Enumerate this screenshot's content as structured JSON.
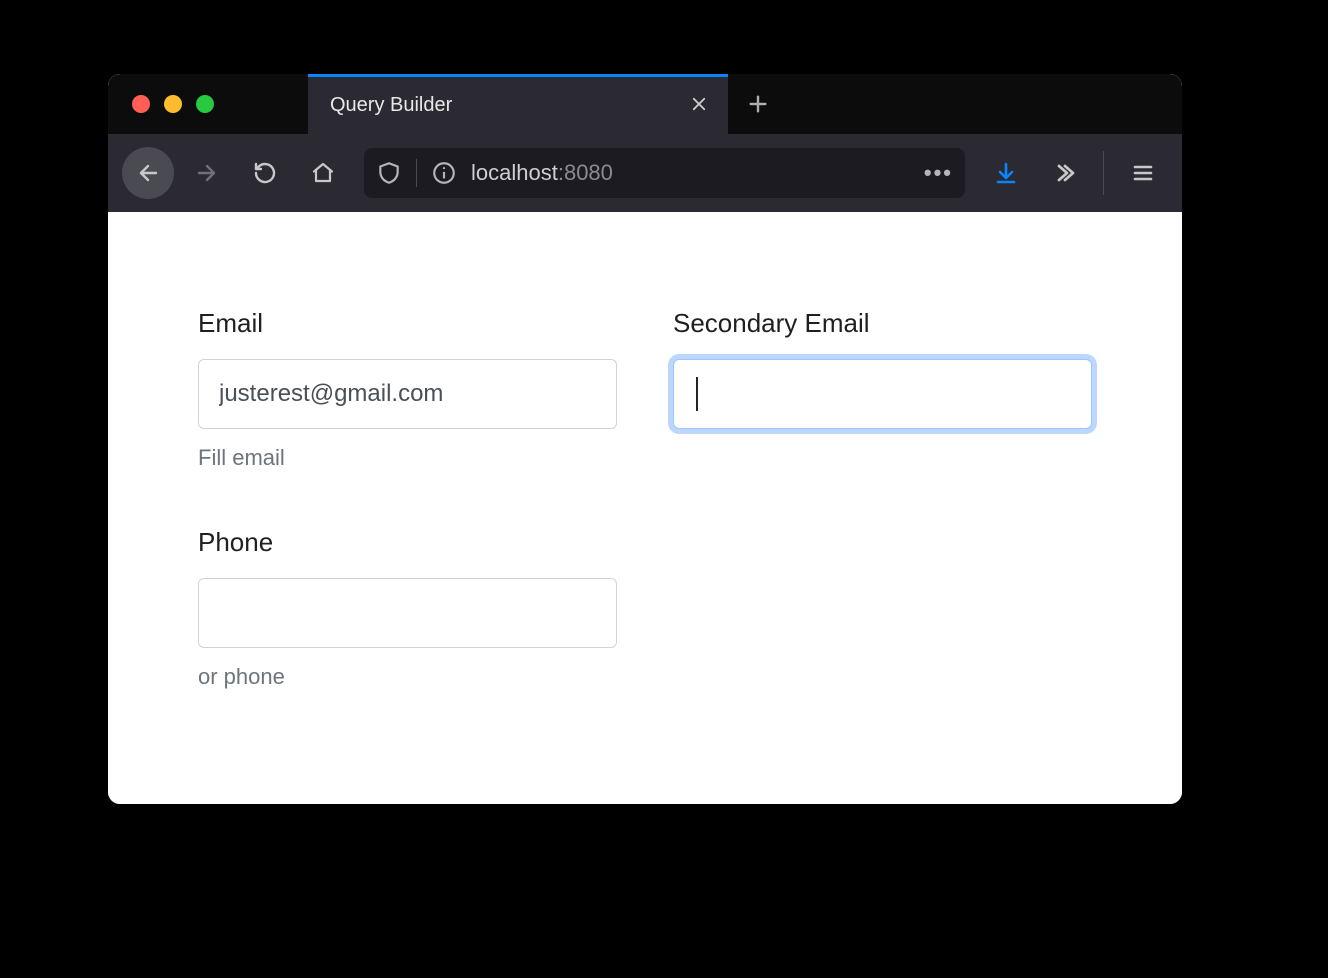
{
  "window": {
    "traffic_colors": {
      "red": "#ff5f57",
      "yellow": "#febc2e",
      "green": "#28c840"
    }
  },
  "tab": {
    "title": "Query Builder"
  },
  "urlbar": {
    "host": "localhost",
    "port": ":8080"
  },
  "form": {
    "email": {
      "label": "Email",
      "value": "justerest@gmail.com",
      "hint": "Fill email"
    },
    "secondary_email": {
      "label": "Secondary Email",
      "value": ""
    },
    "phone": {
      "label": "Phone",
      "value": "",
      "hint": "or phone"
    }
  }
}
